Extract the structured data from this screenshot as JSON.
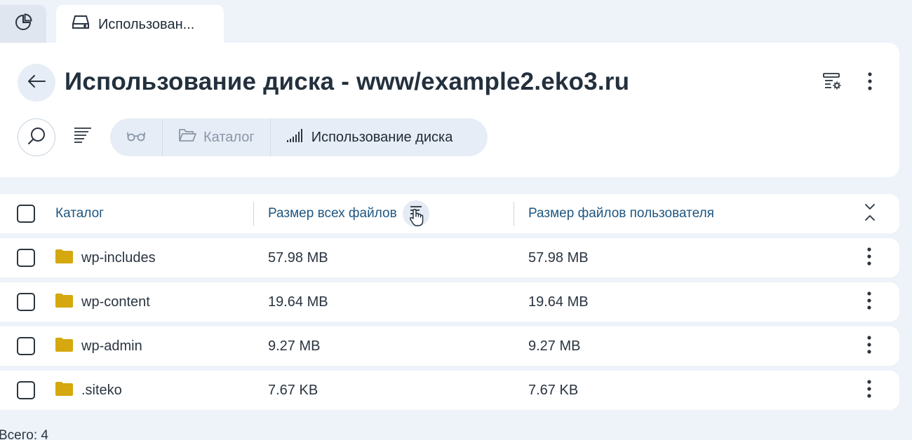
{
  "tabs": {
    "home_icon": "pie-chart-icon",
    "active": {
      "icon": "hard-drive-icon",
      "label": "Использован..."
    }
  },
  "header": {
    "title": "Использование диска - www/example2.eko3.ru"
  },
  "breadcrumbs": [
    {
      "icon": "glasses-icon",
      "label": ""
    },
    {
      "icon": "folder-icon",
      "label": "Каталог"
    },
    {
      "icon": "signal-bars-icon",
      "label": "Использование диска"
    }
  ],
  "table": {
    "columns": {
      "name": "Каталог",
      "total_size": "Размер всех файлов",
      "user_size": "Размер файлов пользователя"
    },
    "rows": [
      {
        "name": "wp-includes",
        "total_size": "57.98 MB",
        "user_size": "57.98 MB"
      },
      {
        "name": "wp-content",
        "total_size": "19.64 MB",
        "user_size": "19.64 MB"
      },
      {
        "name": "wp-admin",
        "total_size": "9.27 MB",
        "user_size": "9.27 MB"
      },
      {
        "name": ".siteko",
        "total_size": "7.67 KB",
        "user_size": "7.67 KB"
      }
    ]
  },
  "footer": {
    "total": "Всего: 4"
  },
  "colors": {
    "background": "#eef2f9",
    "panel": "#ffffff",
    "header_text": "#1e5680",
    "folder": "#d4a80e"
  }
}
